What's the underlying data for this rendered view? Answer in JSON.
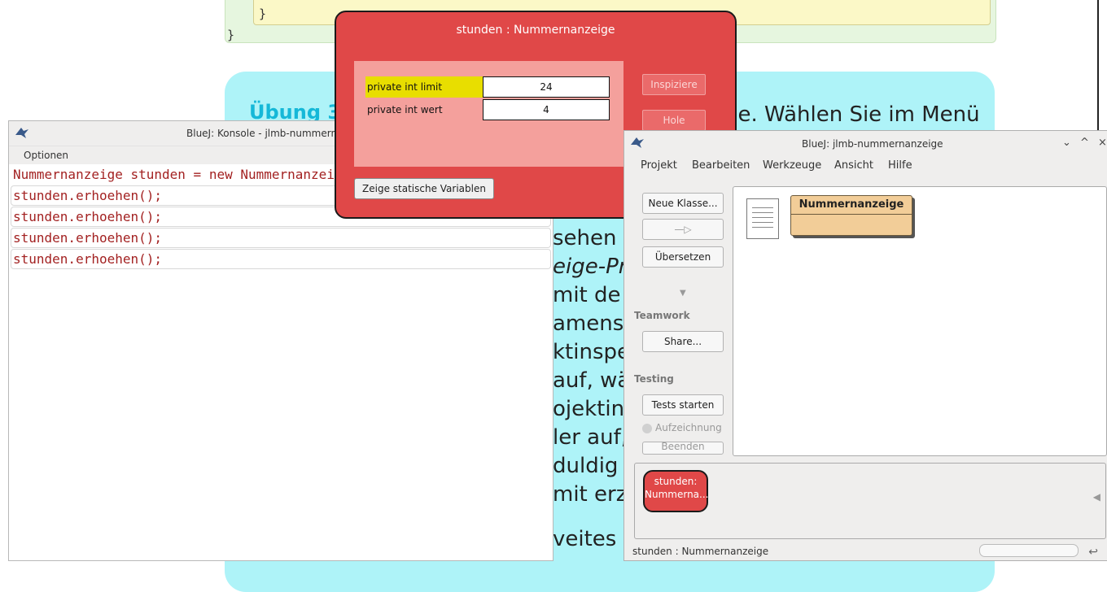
{
  "background_page": {
    "code_closing_inner": "}",
    "code_closing_outer": "}",
    "exercise_title": "Übung 3",
    "exercise_text_top": "ge. Wählen Sie im Menü",
    "exercise_fragments": [
      "sehen –",
      "eige-Proj",
      " mit de",
      "amens.",
      "ktinspek",
      " auf, wä",
      "ojektinsp",
      "ler auf,",
      "duldig s",
      "mit erze",
      "veites Nu"
    ]
  },
  "console_window": {
    "title": "BlueJ: Konsole - jlmb-nummern",
    "menu": [
      "Optionen"
    ],
    "lines": [
      "Nummernanzeige stunden = new Nummernanzeige(24);",
      "stunden.erhoehen();",
      "stunden.erhoehen();",
      "stunden.erhoehen();",
      "stunden.erhoehen();"
    ]
  },
  "inspector": {
    "title": "stunden : Nummernanzeige",
    "fields": [
      {
        "name": "private int limit",
        "value": "24"
      },
      {
        "name": "private int wert",
        "value": "4"
      }
    ],
    "buttons": {
      "inspect": "Inspiziere",
      "get": "Hole",
      "show_static": "Zeige statische Variablen"
    },
    "highlight_color": "#e8de00",
    "object_color": "#e04848"
  },
  "bluej_window": {
    "title": "BlueJ: jlmb-nummernanzeige",
    "window_controls": [
      "⌄",
      "^",
      "×"
    ],
    "menu": [
      "Projekt",
      "Bearbeiten",
      "Werkzeuge",
      "Ansicht",
      "Hilfe"
    ],
    "side": {
      "new_class": "Neue Klasse...",
      "arrow": "—▷",
      "compile": "Übersetzen",
      "teamwork_label": "Teamwork",
      "share": "Share...",
      "testing_label": "Testing",
      "run_tests": "Tests starten",
      "recording": "Aufzeichnung",
      "end": "Beenden"
    },
    "class_name": "Nummernanzeige",
    "class_color": "#f2cd98",
    "object_chip": {
      "line1": "stunden:",
      "line2": "Nummerna..."
    },
    "status_text": "stunden : Nummernanzeige"
  }
}
